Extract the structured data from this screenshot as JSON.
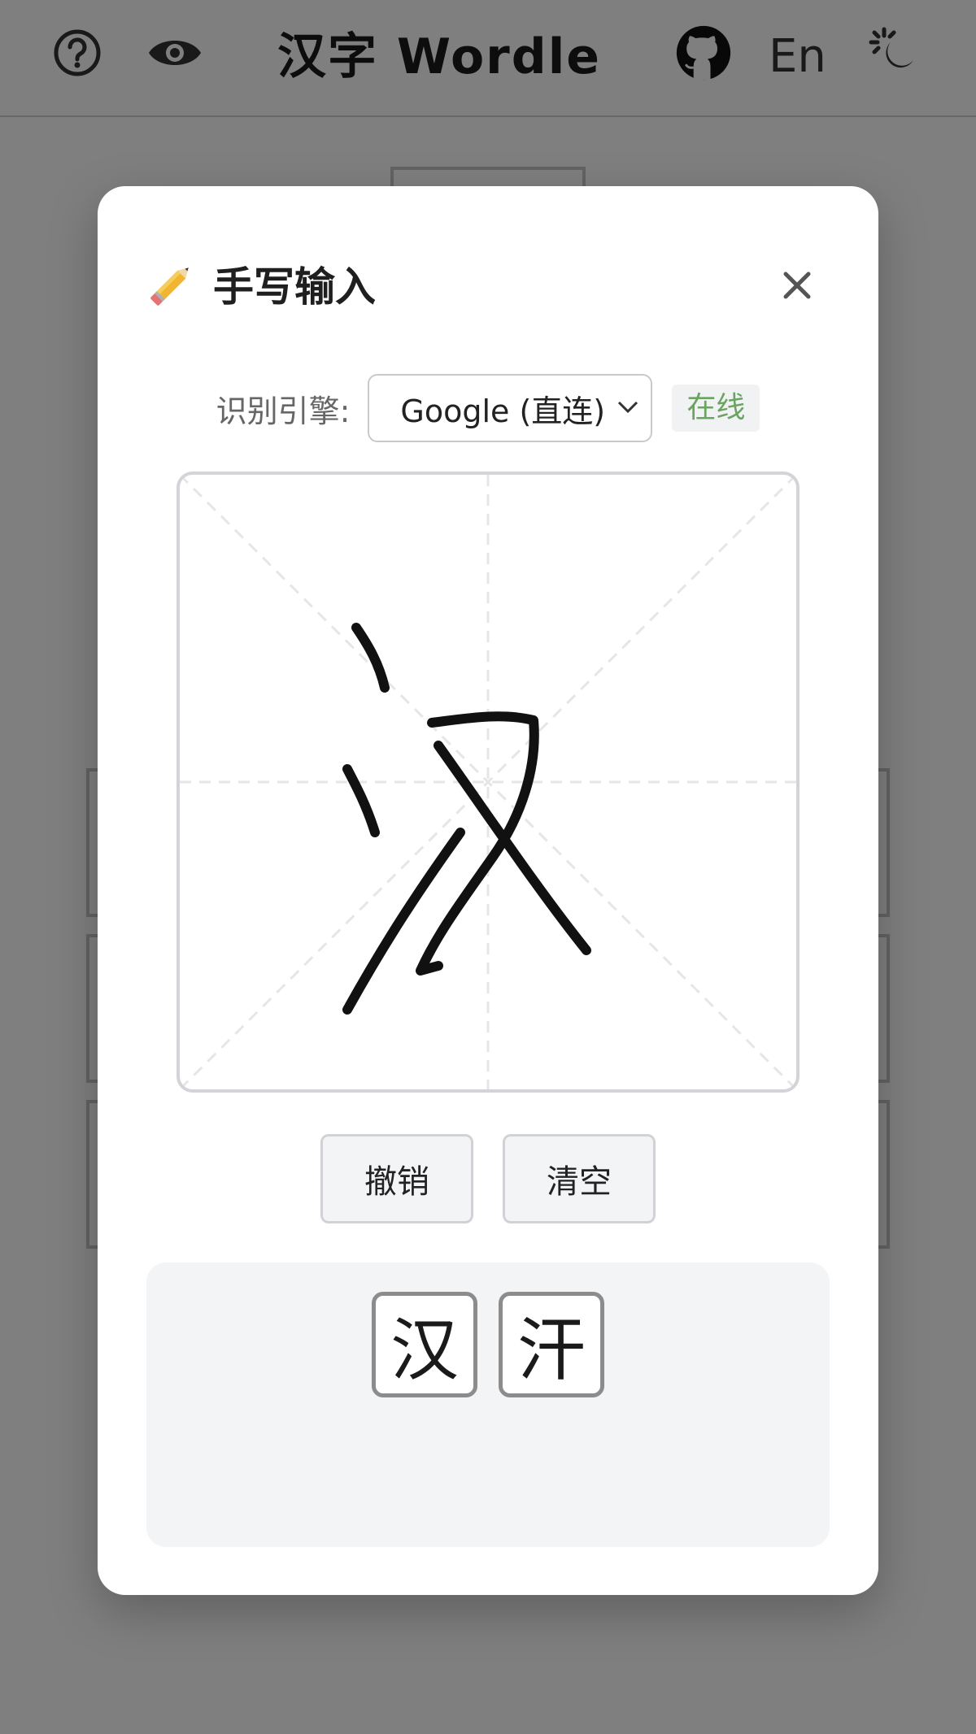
{
  "app": {
    "title": "汉字 Wordle",
    "lang_button": "En"
  },
  "icons": {
    "help": "help-circle-icon",
    "eye": "eye-icon",
    "github": "github-icon",
    "theme": "sun-moon-icon"
  },
  "modal": {
    "title_icon": "✏️",
    "title": "手写输入",
    "close_icon": "✕",
    "engine": {
      "label": "识别引擎:",
      "selected": "Google (直连)",
      "status": "在线"
    },
    "buttons": {
      "undo": "撤销",
      "clear": "清空"
    },
    "candidates": [
      "汉",
      "汗"
    ]
  },
  "colors": {
    "overlay": "#808080",
    "status_green": "#6aa460",
    "panel_bg": "#f3f4f6"
  }
}
